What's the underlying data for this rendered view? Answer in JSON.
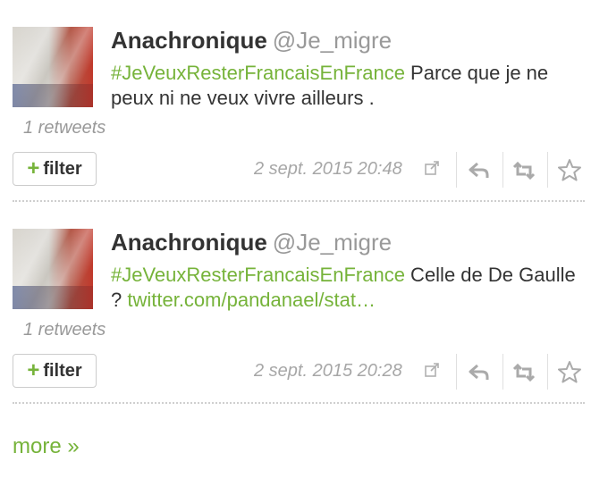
{
  "tweets": [
    {
      "name": "Anachronique",
      "handle": "@Je_migre",
      "hashtag": "#JeVeuxResterFrancaisEnFrance",
      "text": " Parce que je ne peux ni ne veux vivre ailleurs .",
      "link": "",
      "retweets": "1 retweets",
      "filter_label": "filter",
      "date": "2 sept. 2015 20:48"
    },
    {
      "name": "Anachronique",
      "handle": "@Je_migre",
      "hashtag": "#JeVeuxResterFrancaisEnFrance",
      "text": " Celle de De Gaulle ? ",
      "link": "twitter.com/pandanael/stat…",
      "retweets": "1 retweets",
      "filter_label": "filter",
      "date": "2 sept. 2015 20:28"
    }
  ],
  "more_label": "more »",
  "colors": {
    "accent": "#76b33a",
    "muted": "#999999",
    "text": "#333333"
  },
  "icons": [
    "external-link-icon",
    "reply-icon",
    "retweet-icon",
    "favorite-star-icon",
    "plus-icon"
  ]
}
